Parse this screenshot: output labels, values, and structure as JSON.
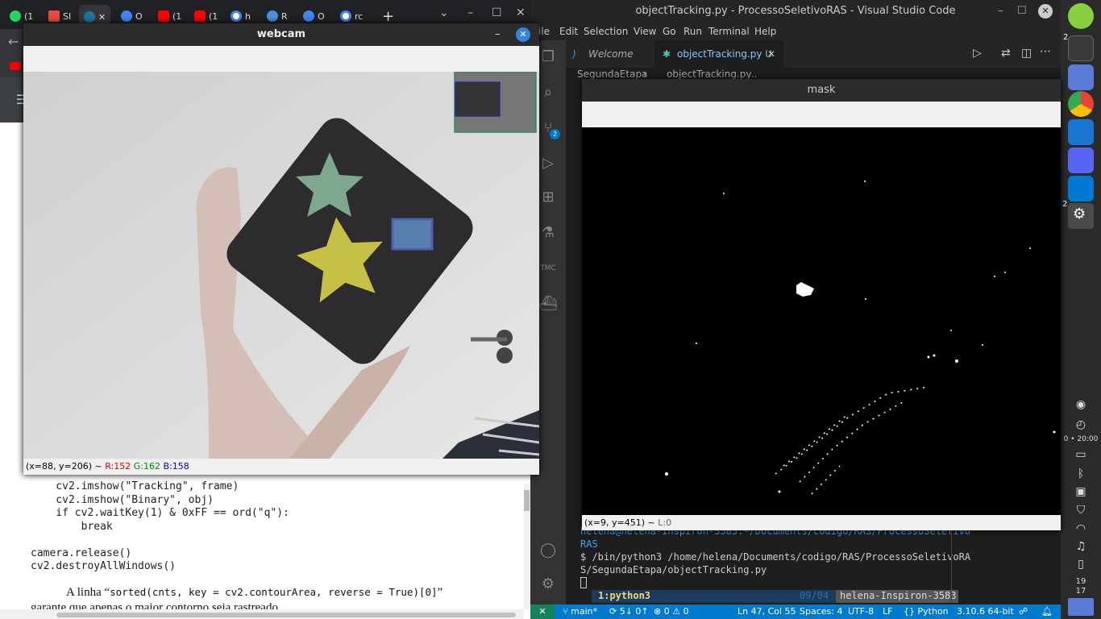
{
  "browser": {
    "tabs": [
      {
        "label": "(1",
        "color": "#25d366"
      },
      {
        "label": "SI",
        "color": "#e74c3c"
      },
      {
        "label": "",
        "color": "#21759b",
        "active": true
      },
      {
        "label": "O",
        "color": "#4285f4"
      },
      {
        "label": "(1",
        "color": "#ff0000"
      },
      {
        "label": "(1",
        "color": "#ff0000"
      },
      {
        "label": "h",
        "color": "#4285f4"
      },
      {
        "label": "R",
        "color": "#4a90d9"
      },
      {
        "label": "O",
        "color": "#4285f4"
      },
      {
        "label": "rc",
        "color": "#4285f4"
      }
    ],
    "new_tab": "+",
    "code_lines": [
      "    cv2.imshow(\"Tracking\", frame)",
      "    cv2.imshow(\"Binary\", obj)",
      "    if cv2.waitKey(1) & 0xFF == ord(\"q\"):",
      "        break",
      "",
      "camera.release()",
      "cv2.destroyAllWindows()"
    ],
    "para_start": "A linha “",
    "para_code": "sorted(cnts, key = cv2.contourArea, reverse = True)[0]",
    "para_end": "”",
    "para_line2": "garante que apenas o maior contorno seja rastreado."
  },
  "vscode": {
    "title": "objectTracking.py - ProcessoSeletivoRAS - Visual Studio Code",
    "menu": [
      "ile",
      "Edit",
      "Selection",
      "View",
      "Go",
      "Run",
      "Terminal",
      "Help"
    ],
    "tabs": [
      {
        "label": "Welcome"
      },
      {
        "label": "objectTracking.py",
        "badge": "U"
      }
    ],
    "breadcrumb": [
      "SegundaEtapa",
      "objectTracking.py",
      "..."
    ],
    "scm_badge": "2",
    "terminal": {
      "prompt_line1": "helena@helena-Inspiron-3583:~/Documents/codigo/RAS/ProcessoSeletivo",
      "prompt_line2": "RAS",
      "cmd_line1": "$ /bin/python3 /home/helena/Documents/codigo/RAS/ProcessoSeletivoRA",
      "cmd_line2": "S/SegundaEtapa/objectTracking.py",
      "session": "1:python3",
      "date": "09/04",
      "host": "helena-Inspiron-3583"
    },
    "status": {
      "branch": "main*",
      "sync": "5↓ 0↑",
      "problems": "⊗ 0 ⚠ 0",
      "position": "Ln 47, Col 55",
      "spaces": "Spaces: 4",
      "encoding": "UTF-8",
      "eol": "LF",
      "language": "Python",
      "interpreter": "3.10.6 64-bit"
    }
  },
  "webcam": {
    "title": "webcam",
    "status_coords": "(x=88, y=206) ~",
    "r": "R:152",
    "g": "G:162",
    "b": "B:158"
  },
  "mask": {
    "title": "mask",
    "status_coords": "(x=9, y=451) ~",
    "level": "L:0"
  },
  "dock": {
    "badge1": "2",
    "badge2": "2",
    "clock": "0 • 20:00",
    "date_day": "19",
    "date_month": "17"
  }
}
